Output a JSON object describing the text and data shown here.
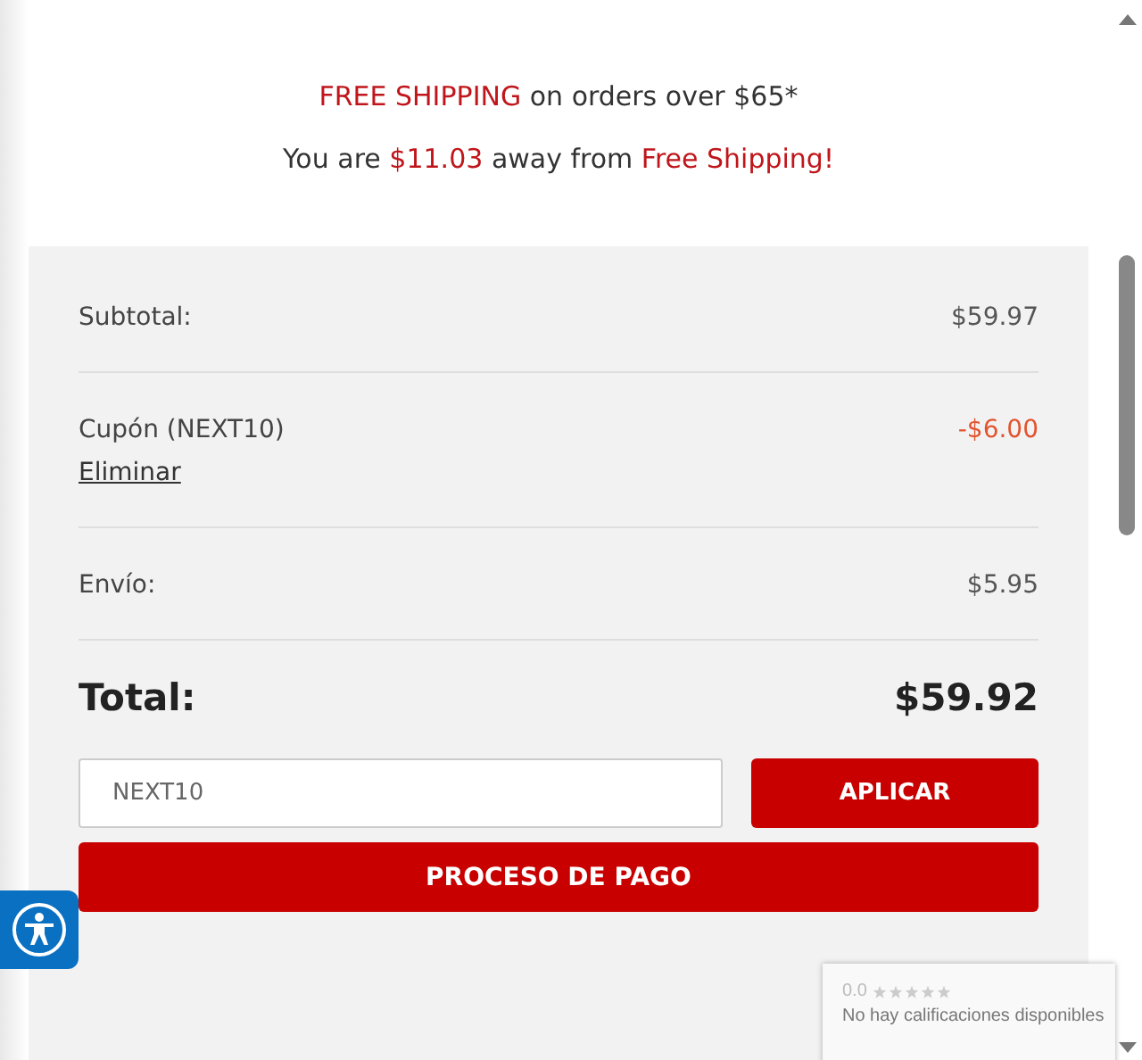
{
  "banner": {
    "lines": [
      [
        {
          "text": "FREE SHIPPING",
          "highlight": true
        },
        {
          "text": " on orders over $65*",
          "highlight": false
        }
      ],
      [
        {
          "text": "You are ",
          "highlight": false
        },
        {
          "text": "$11.03",
          "highlight": true
        },
        {
          "text": " away from ",
          "highlight": false
        },
        {
          "text": "Free Shipping!",
          "highlight": true
        }
      ]
    ]
  },
  "summary": {
    "rows": [
      {
        "kind": "line",
        "label": "Subtotal:",
        "value": "$59.97",
        "discount": false
      },
      {
        "kind": "coupon",
        "label": "Cupón (NEXT10)",
        "link": "Eliminar",
        "value": "-$6.00",
        "discount": true
      },
      {
        "kind": "line",
        "label": "Envío:",
        "value": "$5.95",
        "discount": false
      },
      {
        "kind": "total",
        "label": "Total:",
        "value": "$59.92"
      }
    ],
    "coupon_field": {
      "value": "NEXT10"
    },
    "apply_button": "APLICAR",
    "checkout_button": "PROCESO DE PAGO"
  },
  "rating_badge": {
    "score": "0.0",
    "stars": 0,
    "message": "No hay calificaciones disponibles"
  }
}
